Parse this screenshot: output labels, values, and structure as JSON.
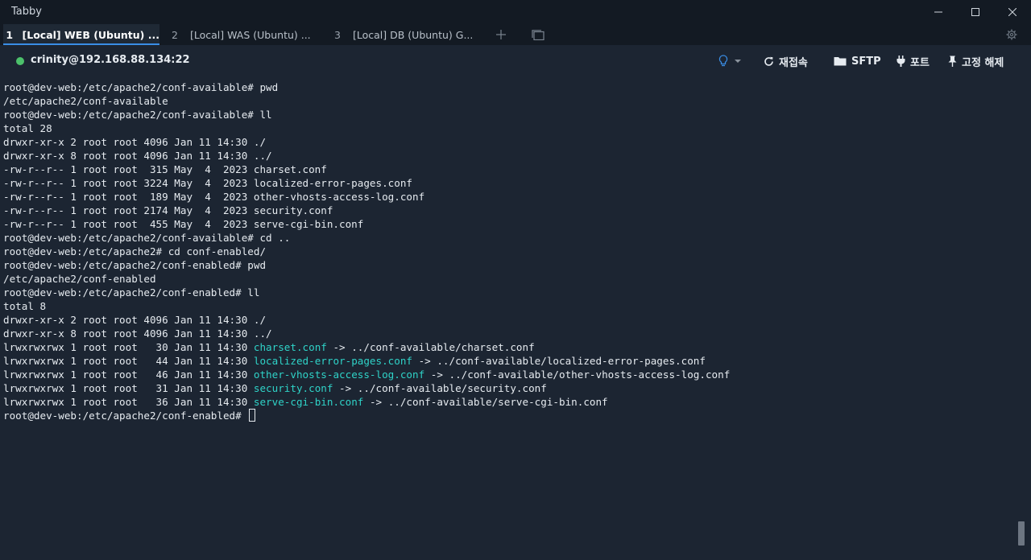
{
  "window": {
    "title": "Tabby"
  },
  "tabs": [
    {
      "num": "1",
      "label": "[Local] WEB (Ubuntu) ...",
      "active": true
    },
    {
      "num": "2",
      "label": "[Local] WAS (Ubuntu) ...",
      "active": false
    },
    {
      "num": "3",
      "label": "[Local] DB (Ubuntu) G...",
      "active": false
    }
  ],
  "toolbar": {
    "connection": "crinity@192.168.88.134:22",
    "status_color": "#4cc16b",
    "reconnect": "재접속",
    "sftp": "SFTP",
    "ports": "포트",
    "unpin": "고정 해제"
  },
  "terminal": {
    "lines": [
      [
        "root@dev-web:/etc/apache2/conf-available# pwd"
      ],
      [
        "/etc/apache2/conf-available"
      ],
      [
        "root@dev-web:/etc/apache2/conf-available# ll"
      ],
      [
        "total 28"
      ],
      [
        "drwxr-xr-x 2 root root 4096 Jan 11 14:30 ./"
      ],
      [
        "drwxr-xr-x 8 root root 4096 Jan 11 14:30 ../"
      ],
      [
        "-rw-r--r-- 1 root root  315 May  4  2023 charset.conf"
      ],
      [
        "-rw-r--r-- 1 root root 3224 May  4  2023 localized-error-pages.conf"
      ],
      [
        "-rw-r--r-- 1 root root  189 May  4  2023 other-vhosts-access-log.conf"
      ],
      [
        "-rw-r--r-- 1 root root 2174 May  4  2023 security.conf"
      ],
      [
        "-rw-r--r-- 1 root root  455 May  4  2023 serve-cgi-bin.conf"
      ],
      [
        "root@dev-web:/etc/apache2/conf-available# cd .."
      ],
      [
        "root@dev-web:/etc/apache2# cd conf-enabled/"
      ],
      [
        "root@dev-web:/etc/apache2/conf-enabled# pwd"
      ],
      [
        "/etc/apache2/conf-enabled"
      ],
      [
        "root@dev-web:/etc/apache2/conf-enabled# ll"
      ],
      [
        "total 8"
      ],
      [
        "drwxr-xr-x 2 root root 4096 Jan 11 14:30 ./"
      ],
      [
        "drwxr-xr-x 8 root root 4096 Jan 11 14:30 ../"
      ],
      [
        "lrwxrwxrwx 1 root root   30 Jan 11 14:30 ",
        "charset.conf",
        " -> ../conf-available/charset.conf"
      ],
      [
        "lrwxrwxrwx 1 root root   44 Jan 11 14:30 ",
        "localized-error-pages.conf",
        " -> ../conf-available/localized-error-pages.conf"
      ],
      [
        "lrwxrwxrwx 1 root root   46 Jan 11 14:30 ",
        "other-vhosts-access-log.conf",
        " -> ../conf-available/other-vhosts-access-log.conf"
      ],
      [
        "lrwxrwxrwx 1 root root   31 Jan 11 14:30 ",
        "security.conf",
        " -> ../conf-available/security.conf"
      ],
      [
        "lrwxrwxrwx 1 root root   36 Jan 11 14:30 ",
        "serve-cgi-bin.conf",
        " -> ../conf-available/serve-cgi-bin.conf"
      ],
      [
        "root@dev-web:/etc/apache2/conf-enabled# "
      ]
    ],
    "link_color": "#2fd3c8"
  }
}
